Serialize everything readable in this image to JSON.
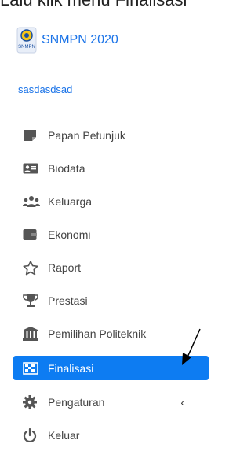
{
  "page_header_text": "Lalu klik menu Finalisasi",
  "brand": {
    "title": "SNMPN 2020",
    "logo_text": "SNMPN"
  },
  "user": {
    "name": "sasdasdsad"
  },
  "menu": {
    "items": [
      {
        "label": "Papan Petunjuk",
        "icon": "board-icon"
      },
      {
        "label": "Biodata",
        "icon": "id-card-icon"
      },
      {
        "label": "Keluarga",
        "icon": "users-icon"
      },
      {
        "label": "Ekonomi",
        "icon": "wallet-icon"
      },
      {
        "label": "Raport",
        "icon": "star-icon"
      },
      {
        "label": "Prestasi",
        "icon": "trophy-icon"
      },
      {
        "label": "Pemilihan Politeknik",
        "icon": "building-icon"
      },
      {
        "label": "Finalisasi",
        "icon": "flag-icon",
        "active": true
      },
      {
        "label": "Pengaturan",
        "icon": "gear-icon"
      },
      {
        "label": "Keluar",
        "icon": "power-icon"
      }
    ],
    "expand_glyph": "‹"
  },
  "colors": {
    "accent": "#0d7cf2",
    "brand_text": "#1a73e8"
  }
}
